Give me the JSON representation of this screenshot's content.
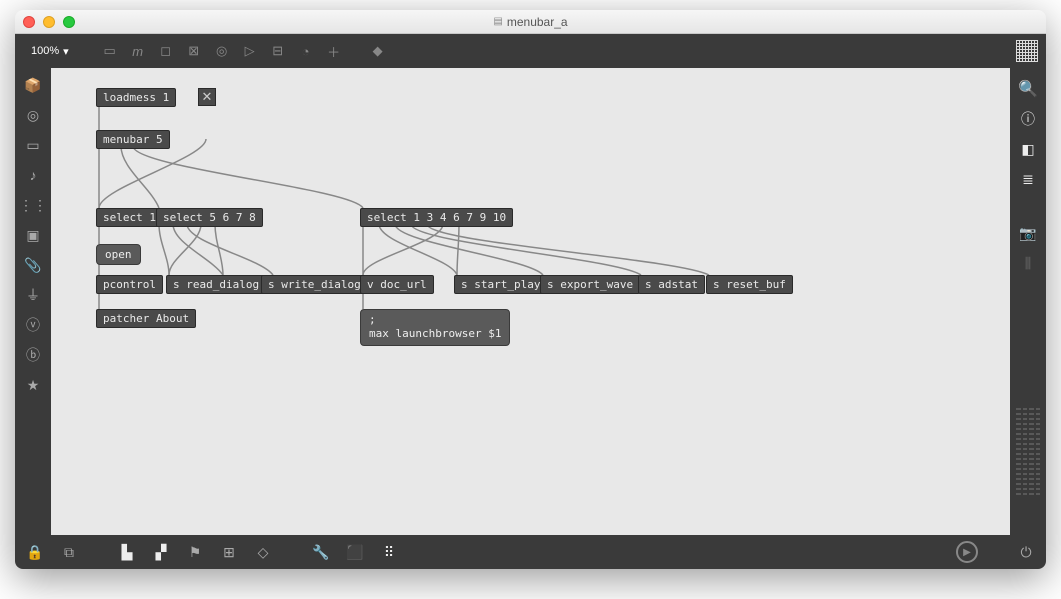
{
  "window": {
    "title": "menubar_a"
  },
  "toolbar": {
    "zoom": "100%"
  },
  "objects": {
    "loadmess": "loadmess 1",
    "menubar": "menubar 5",
    "select1": "select 1",
    "select5678": "select 5 6 7 8",
    "select13467910": "select 1 3 4 6 7 9 10",
    "open": "open",
    "pcontrol": "pcontrol",
    "s_read_dialog": "s read_dialog",
    "s_write_dialog": "s write_dialog",
    "v_doc_url": "v doc_url",
    "s_start_play": "s start_play",
    "s_export_wave": "s export_wave",
    "s_adstat": "s adstat",
    "s_reset_buf": "s reset_buf",
    "patcher_about": "patcher About",
    "launch": ";\nmax launchbrowser $1"
  }
}
